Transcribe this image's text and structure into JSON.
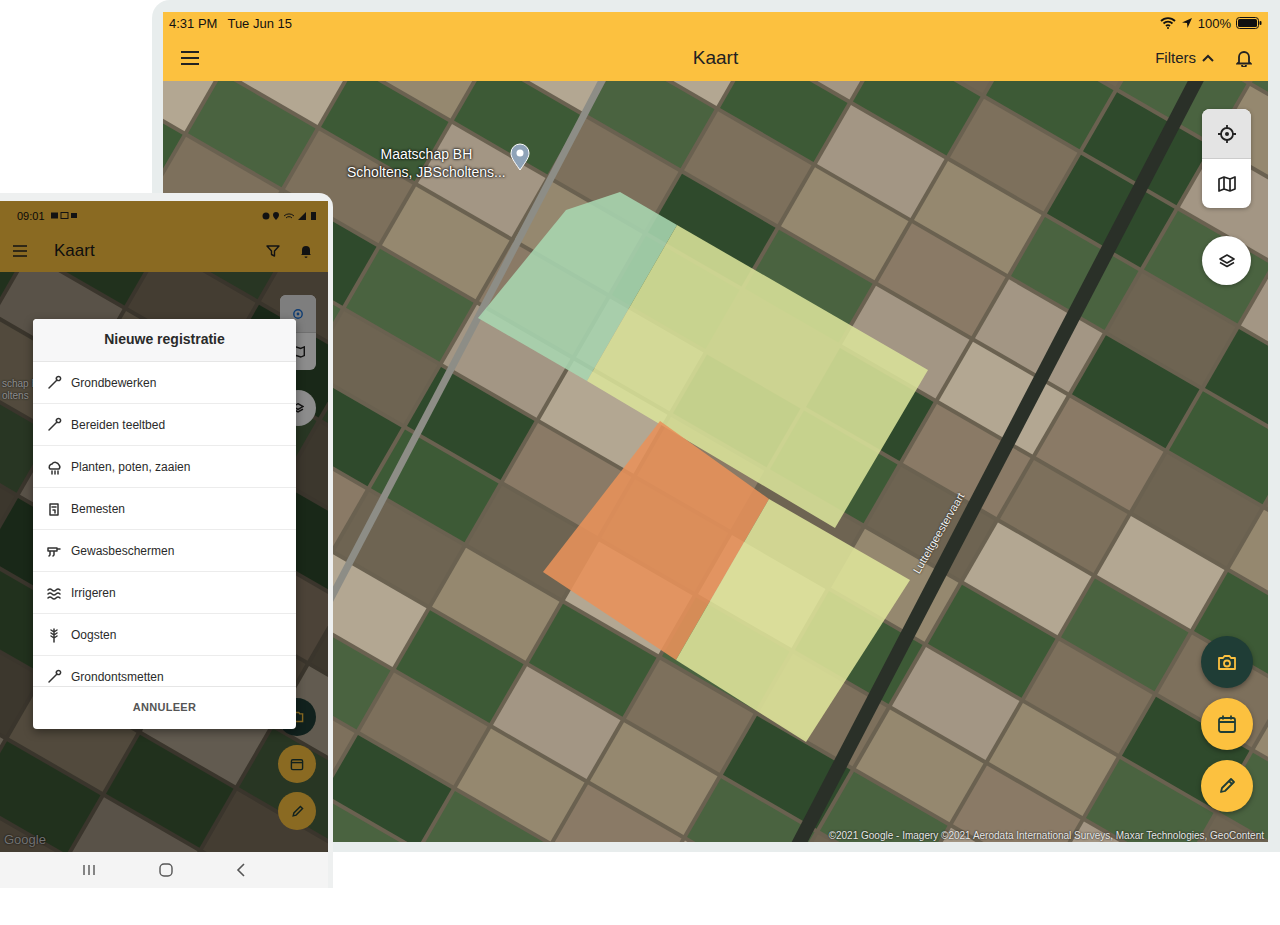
{
  "tablet": {
    "status_bar": {
      "time": "4:31 PM",
      "date": "Tue Jun 15",
      "battery": "100%"
    },
    "app_bar": {
      "title": "Kaart",
      "filters": "Filters"
    },
    "map": {
      "marker": {
        "lines": [
          "Maatschap BH",
          "Scholtens, JBScholtens..."
        ]
      },
      "road_label": "Lutteltgeestervaart",
      "attribution": "©2021 Google - Imagery ©2021 Aerodata International Surveys, Maxar Technologies, GeoContent",
      "fields": [
        {
          "color": "#a9d6b1"
        },
        {
          "color": "#d9e39a"
        },
        {
          "color": "#e8925a"
        },
        {
          "color": "#dfe59b"
        }
      ]
    }
  },
  "phone": {
    "status_bar": {
      "time": "09:01"
    },
    "app_bar": {
      "title": "Kaart"
    },
    "map": {
      "marker_lines": [
        "schap B",
        "oltens"
      ],
      "logo": "Google"
    },
    "dialog": {
      "title": "Nieuwe registratie",
      "items": [
        "Grondbewerken",
        "Bereiden teeltbed",
        "Planten, poten, zaaien",
        "Bemesten",
        "Gewasbeschermen",
        "Irrigeren",
        "Oogsten",
        "Grondontsmetten"
      ],
      "cancel": "ANNULEER"
    }
  }
}
